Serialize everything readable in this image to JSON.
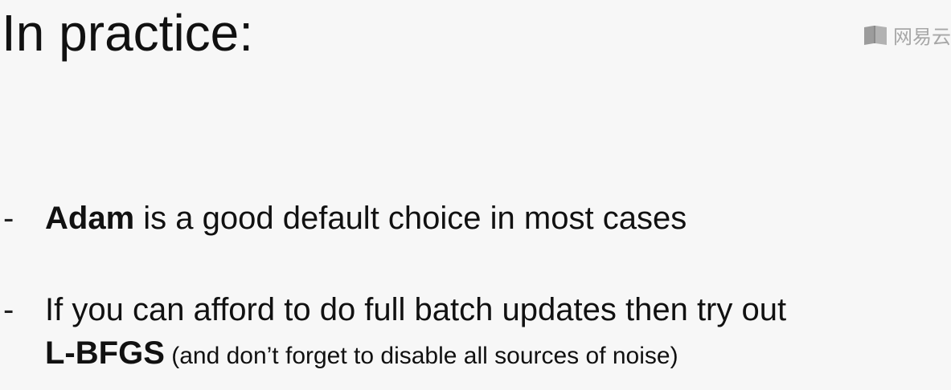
{
  "slide": {
    "title": "In practice:"
  },
  "watermark": {
    "icon": "book-logo-icon",
    "text": "网易云"
  },
  "bullets": [
    {
      "marker": "-",
      "bold": "Adam",
      "text": " is a good default choice in most cases"
    },
    {
      "marker": "-",
      "line1": "If you can afford to do full batch updates then try out",
      "bold": "L-BFGS",
      "note": " (and don’t forget to disable all sources of noise)"
    }
  ],
  "colors": {
    "background": "#f7f7f7",
    "text": "#111111",
    "watermark": "#9a9a9a"
  }
}
